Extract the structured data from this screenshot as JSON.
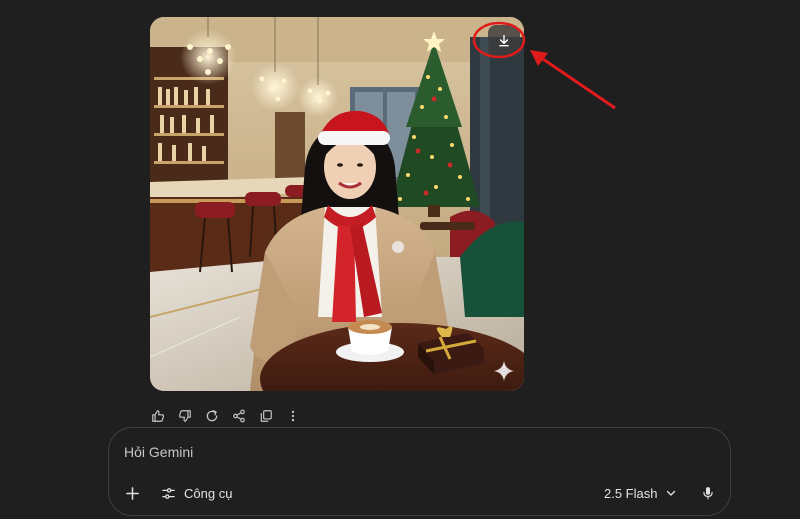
{
  "image": {
    "description_icon": "generated-image",
    "download_icon": "download-icon",
    "sparkle_icon": "sparkle-icon"
  },
  "actions": {
    "icons": [
      "thumbs-up-icon",
      "thumbs-down-icon",
      "redo-icon",
      "share-icon",
      "copy-icon",
      "more-vert-icon"
    ]
  },
  "prompt": {
    "placeholder": "Hỏi Gemini",
    "tools_label": "Công cụ",
    "model_label": "2.5 Flash"
  },
  "colors": {
    "background": "#1f1f1f",
    "annotation": "#e01b1b",
    "border": "#3e3f42"
  }
}
